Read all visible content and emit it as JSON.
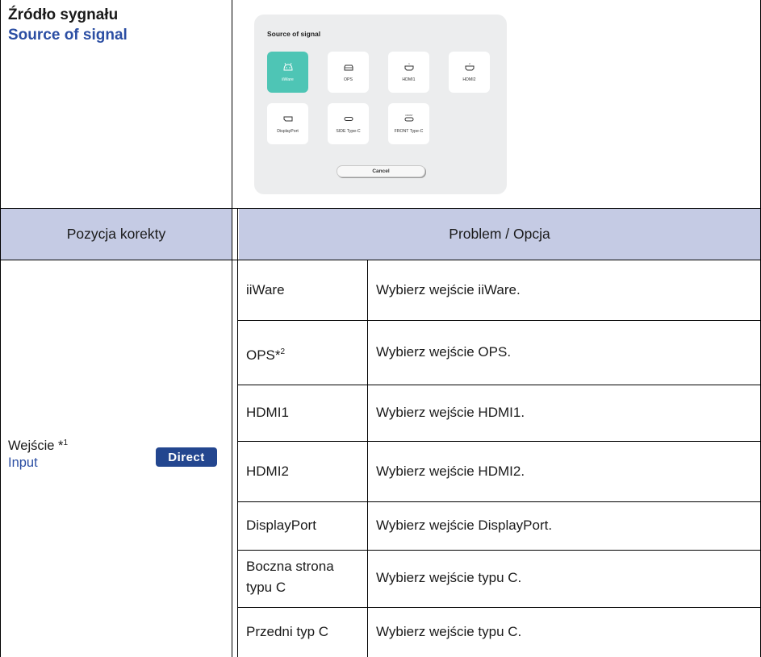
{
  "section": {
    "title_pl": "Źródło sygnału",
    "title_en": "Source of signal"
  },
  "dialog": {
    "title": "Source of signal",
    "sources": [
      {
        "label": "iiWare",
        "icon": "android-icon",
        "selected": true
      },
      {
        "label": "OPS",
        "icon": "ops-icon",
        "selected": false
      },
      {
        "label": "HDMI1",
        "icon": "hdmi-icon",
        "selected": false
      },
      {
        "label": "HDMI2",
        "icon": "hdmi-icon",
        "selected": false
      },
      {
        "label": "DisplayPort",
        "icon": "displayport-icon",
        "selected": false
      },
      {
        "label": "SIDE Type-C",
        "icon": "usb-c-icon",
        "selected": false
      },
      {
        "label": "FRONT Type-C",
        "icon": "usb-c-icon",
        "selected": false
      }
    ],
    "hdmi1_mark": "1",
    "hdmi2_mark": "2",
    "front_mark": "FRONT",
    "cancel_label": "Cancel",
    "accent_color": "#4ec5b5"
  },
  "table": {
    "header_left": "Pozycja korekty",
    "header_right": "Problem / Opcja",
    "item_pl": "Wejście *",
    "item_pl_sup": "1",
    "item_en": "Input",
    "direct_badge": "Direct",
    "rows": [
      {
        "option": "iiWare",
        "sup": "",
        "description": "Wybierz wejście iiWare."
      },
      {
        "option": "OPS*",
        "sup": "2",
        "description": "Wybierz wejście OPS."
      },
      {
        "option": "HDMI1",
        "sup": "",
        "description": "Wybierz wejście HDMI1."
      },
      {
        "option": "HDMI2",
        "sup": "",
        "description": "Wybierz wejście HDMI2."
      },
      {
        "option": "DisplayPort",
        "sup": "",
        "description": "Wybierz wejście DisplayPort."
      },
      {
        "option_line1": "Boczna strona",
        "option_line2": "typu C",
        "description": "Wybierz wejście typu C."
      },
      {
        "option": "Przedni typ C",
        "sup": "",
        "description": "Wybierz wejście typu C."
      }
    ],
    "header_color": "#c5cbe4",
    "badge_color": "#23468f"
  }
}
